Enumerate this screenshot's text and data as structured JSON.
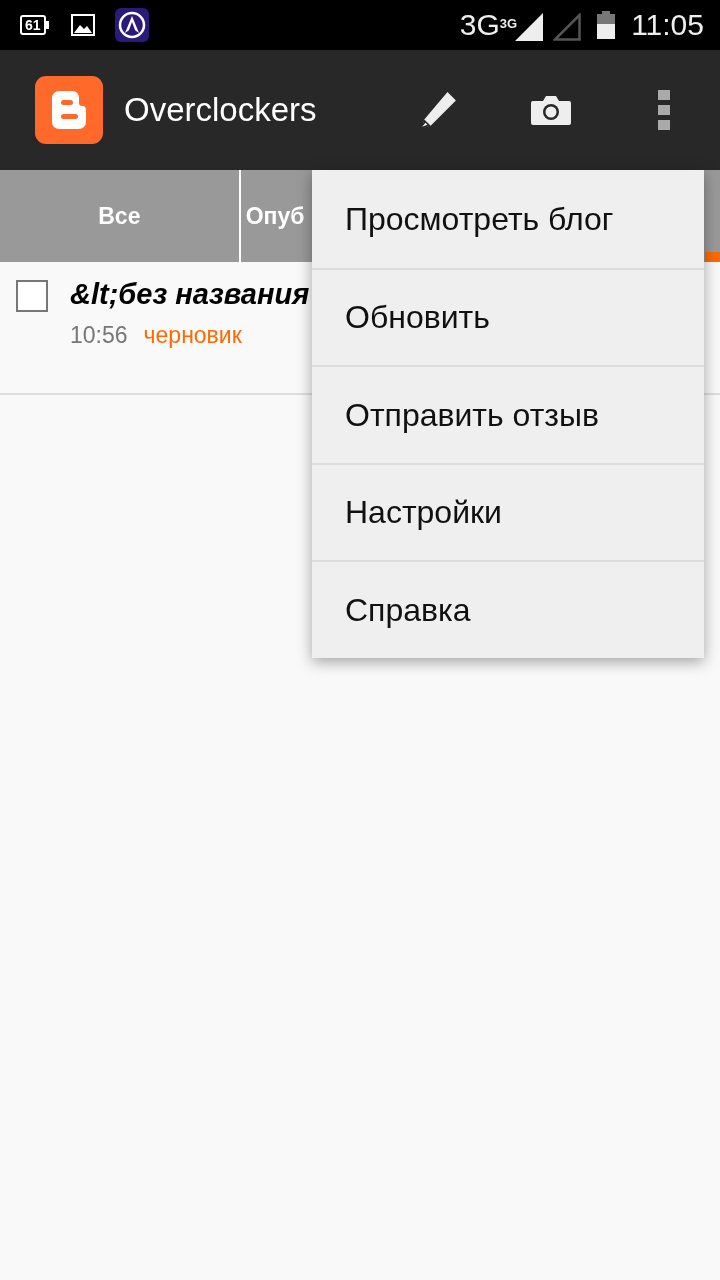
{
  "status_bar": {
    "notification_badge": "61",
    "network_type": "3G",
    "network_type_small": "3G",
    "time": "11:05"
  },
  "app_bar": {
    "title": "Overclockers"
  },
  "tabs": [
    {
      "label": "Все",
      "selected": false
    },
    {
      "label": "Опуб",
      "selected": false
    },
    {
      "selected": true
    }
  ],
  "posts": [
    {
      "title": "&lt;без названия",
      "time": "10:56",
      "status": "черновик",
      "checked": false
    }
  ],
  "overflow_menu": {
    "items": [
      {
        "label": "Просмотреть блог"
      },
      {
        "label": "Обновить"
      },
      {
        "label": "Отправить отзыв"
      },
      {
        "label": "Настройки"
      },
      {
        "label": "Справка"
      }
    ]
  }
}
